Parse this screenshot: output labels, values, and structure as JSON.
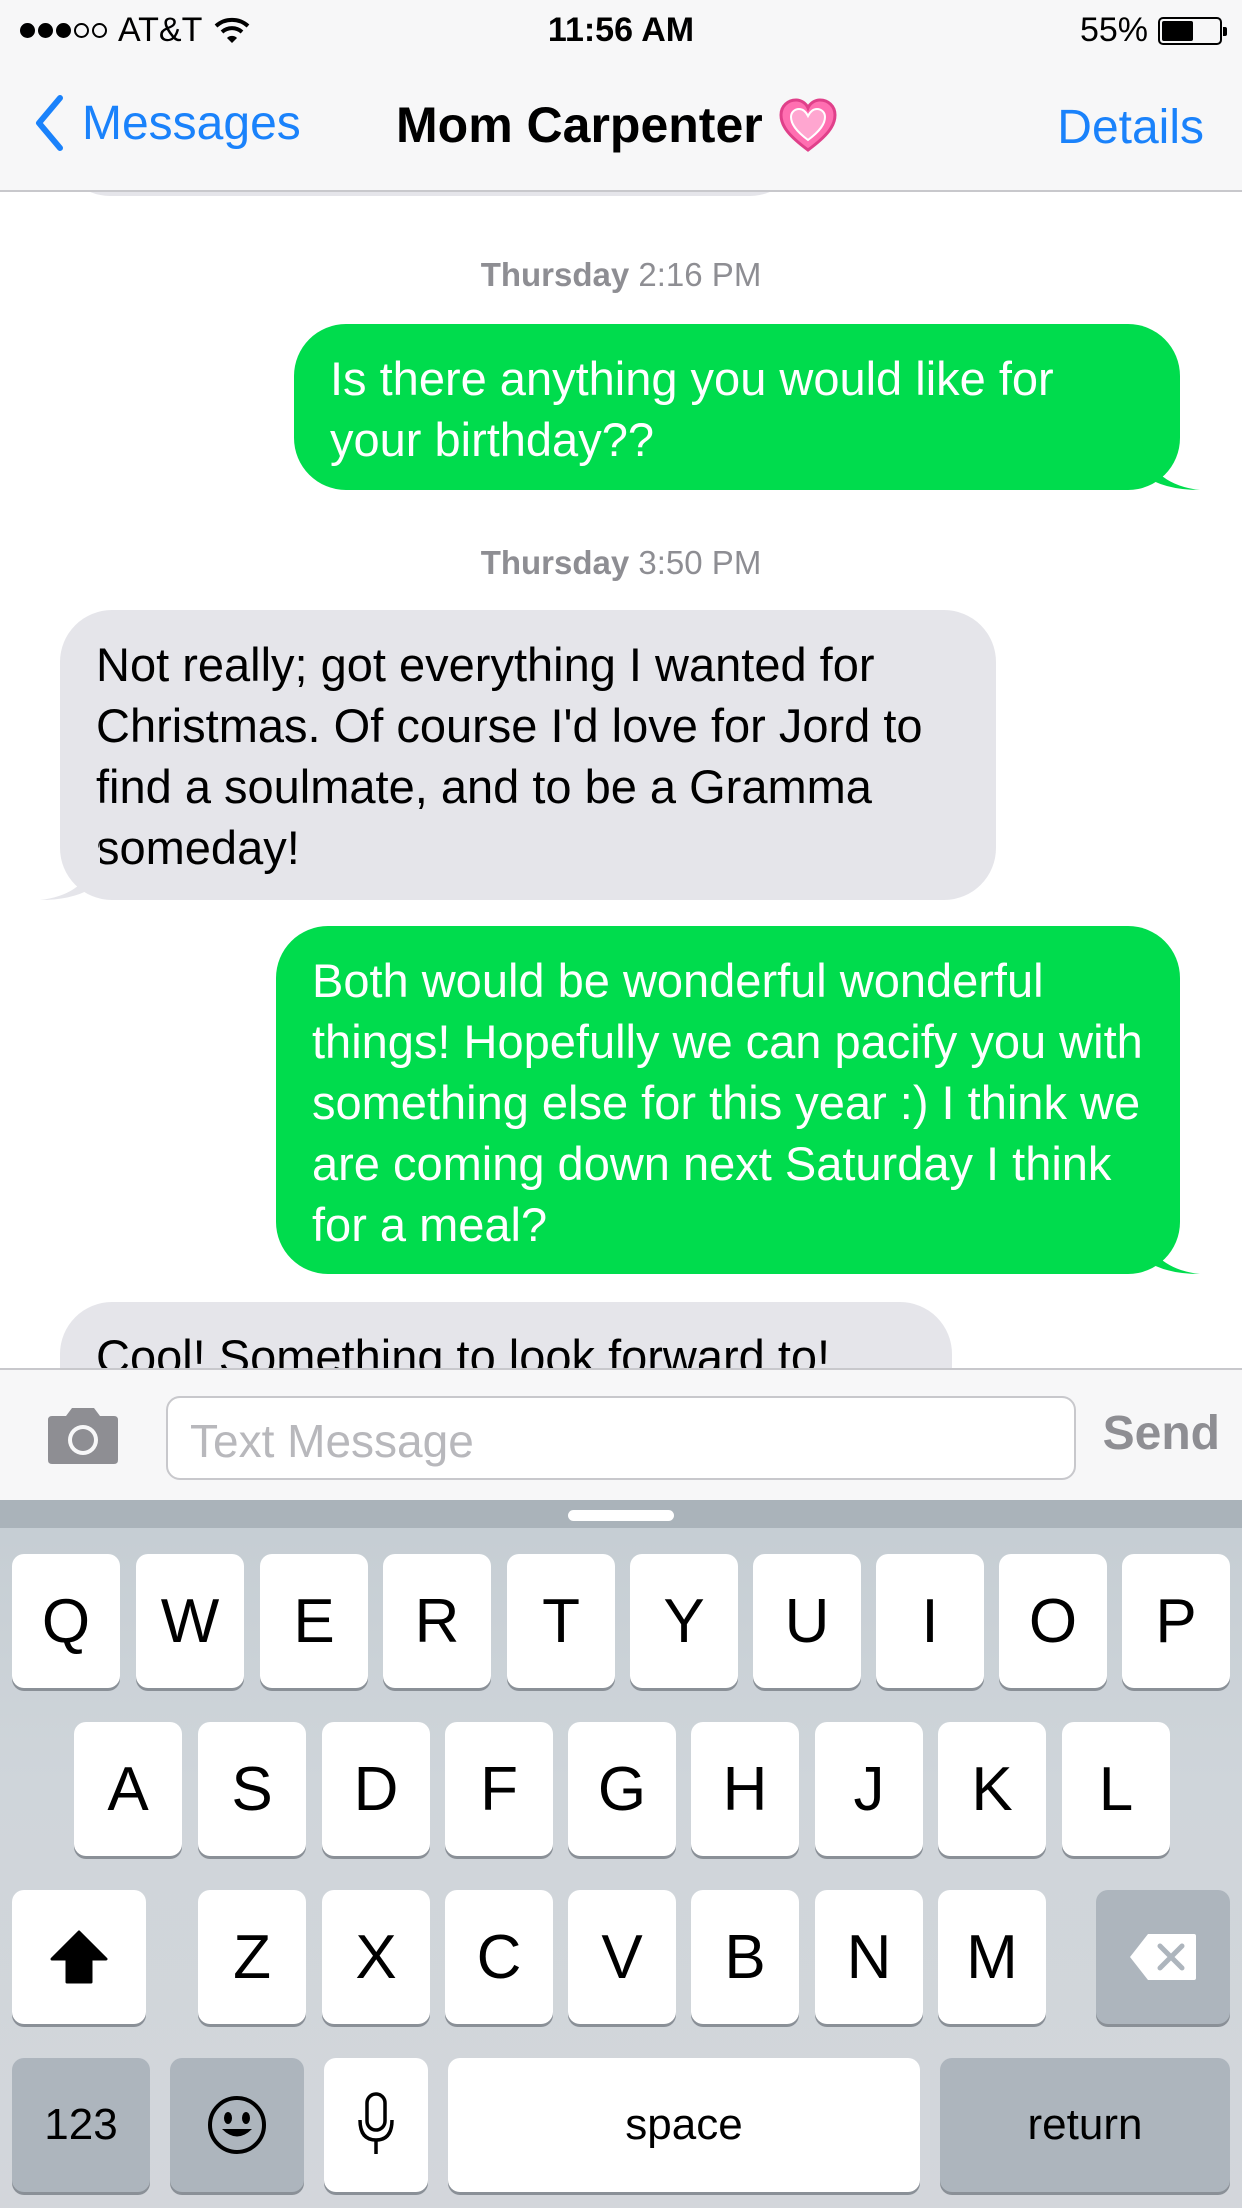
{
  "status_bar": {
    "carrier": "AT&T",
    "time": "11:56 AM",
    "battery": "55%",
    "battery_level": 0.55,
    "signal_bars": 3
  },
  "nav": {
    "back_label": "Messages",
    "title": "Mom Carpenter",
    "details_label": "Details"
  },
  "conversation": {
    "messages": [
      {
        "type": "timestamp",
        "day": "Thursday",
        "time": "2:16 PM"
      },
      {
        "type": "sent",
        "text": "Is there anything you would like for your birthday??"
      },
      {
        "type": "timestamp",
        "day": "Thursday",
        "time": "3:50 PM"
      },
      {
        "type": "received",
        "text": "Not really; got everything I wanted for Christmas. Of course I'd love for Jord to find a soulmate, and to be a Gramma someday!"
      },
      {
        "type": "sent",
        "text": "Both would be wonderful wonderful things! Hopefully we can pacify you with something else for this year :) I think we are coming down next Saturday I think for a meal?"
      },
      {
        "type": "received",
        "text": "Cool! Something to look forward to!"
      }
    ]
  },
  "input": {
    "placeholder": "Text Message",
    "send_label": "Send"
  },
  "keyboard": {
    "row1": [
      "Q",
      "W",
      "E",
      "R",
      "T",
      "Y",
      "U",
      "I",
      "O",
      "P"
    ],
    "row2": [
      "A",
      "S",
      "D",
      "F",
      "G",
      "H",
      "J",
      "K",
      "L"
    ],
    "row3": [
      "Z",
      "X",
      "C",
      "V",
      "B",
      "N",
      "M"
    ],
    "numbers_label": "123",
    "space_label": "space",
    "return_label": "return"
  },
  "colors": {
    "accent": "#1a82fb",
    "sent_bubble": "#00dc4d",
    "received_bubble": "#e5e5ea",
    "timestamp": "#8e8e93"
  },
  "icons": [
    "chevron-left-icon",
    "heart-icon",
    "camera-icon",
    "shift-icon",
    "delete-icon",
    "emoji-icon",
    "microphone-icon",
    "wifi-icon",
    "battery-icon"
  ]
}
